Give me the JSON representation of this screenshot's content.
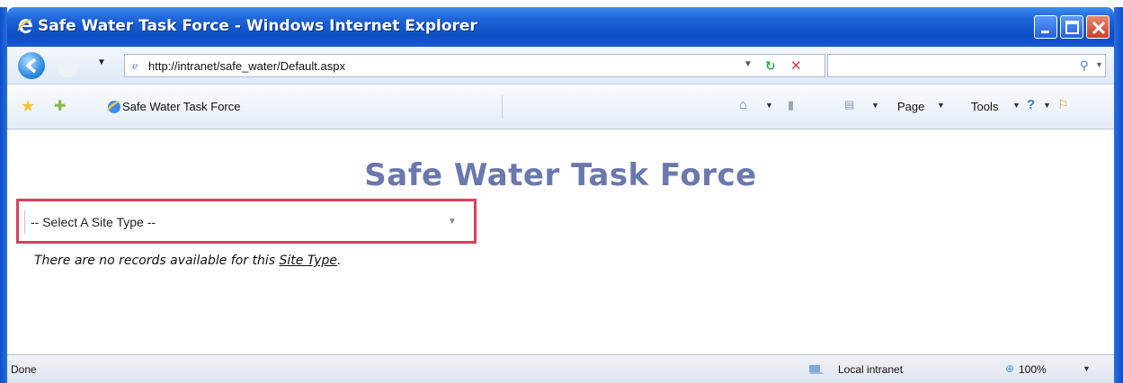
{
  "window": {
    "title": "Safe Water Task Force - Windows Internet Explorer"
  },
  "address_bar": {
    "url": "http://intranet/safe_water/Default.aspx"
  },
  "tab": {
    "title": "Safe Water Task Force"
  },
  "command_bar": {
    "page_label": "Page",
    "tools_label": "Tools"
  },
  "page": {
    "heading": "Safe Water Task Force",
    "site_type_select": {
      "selected": "-- Select A Site Type --"
    },
    "no_records_prefix": "There are no records available for this ",
    "no_records_link": "Site Type",
    "no_records_suffix": "."
  },
  "status_bar": {
    "status": "Done",
    "zone": "Local intranet",
    "zoom": "100%"
  },
  "colors": {
    "title_bar": "#0d4fc4",
    "heading": "#6a78ad",
    "select_highlight": "#d6405c"
  },
  "icons": {
    "window": "ie-logo-icon",
    "back": "back-arrow-icon",
    "refresh": "refresh-icon",
    "stop": "stop-icon",
    "search": "search-icon",
    "favorites": "star-icon",
    "add_favorite": "add-favorite-icon",
    "home": "home-icon",
    "feeds": "feeds-icon",
    "print": "print-icon",
    "help": "help-icon",
    "research": "research-icon",
    "zone": "intranet-zone-icon",
    "zoom": "zoom-icon"
  }
}
